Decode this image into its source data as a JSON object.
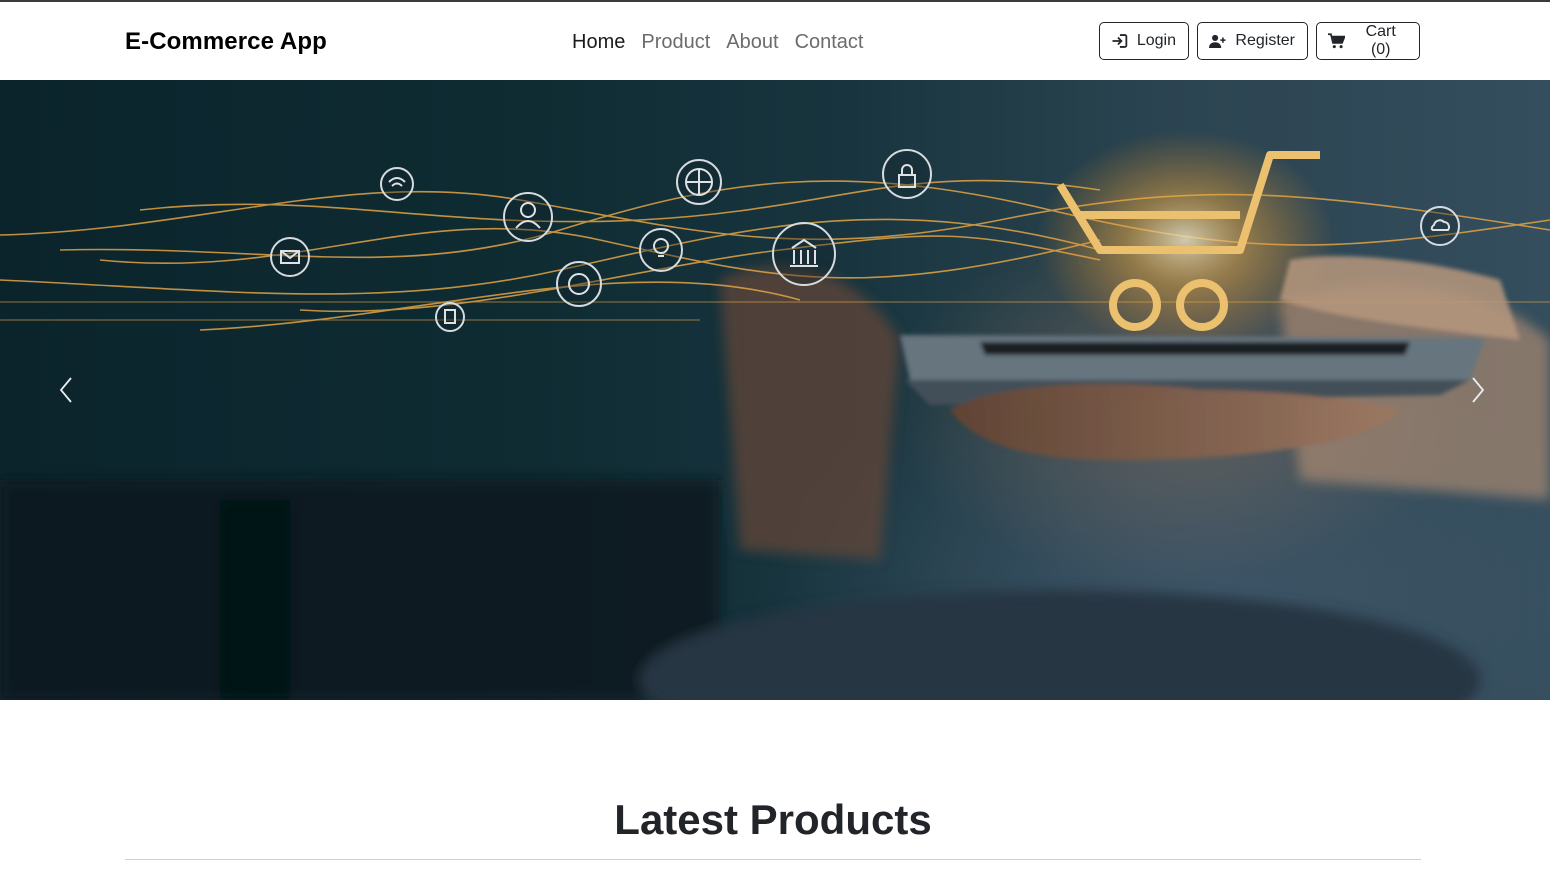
{
  "navbar": {
    "brand": "E-Commerce App",
    "links": [
      {
        "label": "Home",
        "active": true
      },
      {
        "label": "Product",
        "active": false
      },
      {
        "label": "About",
        "active": false
      },
      {
        "label": "Contact",
        "active": false
      }
    ],
    "actions": {
      "login": {
        "label": "Login",
        "icon": "sign-in-icon"
      },
      "register": {
        "label": "Register",
        "icon": "user-plus-icon"
      },
      "cart": {
        "label": "Cart (0)",
        "icon": "shopping-cart-icon"
      }
    }
  },
  "hero": {
    "image": "hand holding tablet with glowing shopping cart and network icons",
    "prev_icon": "chevron-left-icon",
    "next_icon": "chevron-right-icon",
    "accent_color": "#f7b955"
  },
  "section": {
    "title": "Latest Products"
  }
}
